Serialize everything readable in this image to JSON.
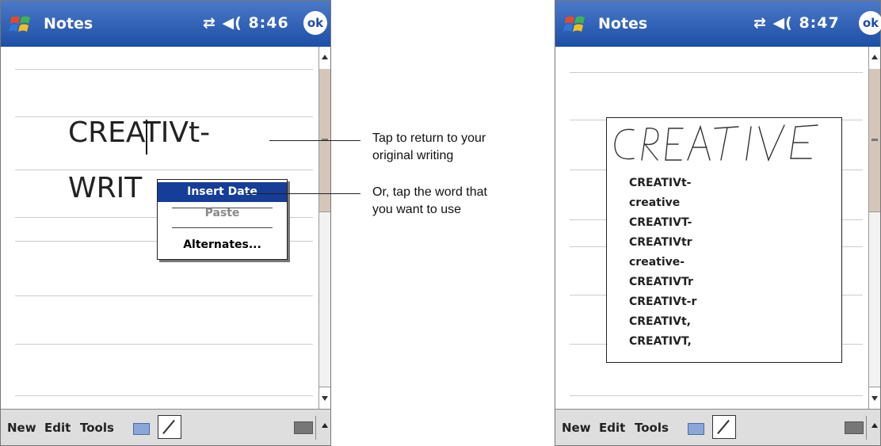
{
  "screen1": {
    "title": "Notes",
    "status": "⇄ ◀( 8:46",
    "ok": "ok",
    "text_line1": "CREATIVt-",
    "text_line2": "WRIT",
    "context_menu": {
      "items": [
        {
          "label": "Insert Date",
          "state": "highlighted"
        },
        {
          "label": "Paste",
          "state": "disabled"
        },
        {
          "label": "Alternates...",
          "state": "normal"
        }
      ]
    },
    "toolbar": {
      "new": "New",
      "edit": "Edit",
      "tools": "Tools"
    }
  },
  "screen2": {
    "title": "Notes",
    "status": "⇄ ◀( 8:47",
    "ok": "ok",
    "ink_word": "CREATIVE",
    "alternates": [
      "CREATIVt-",
      "creative",
      "CREATIVT-",
      "CREATIVtr",
      "creative-",
      "CREATIVTr",
      "CREATIVt-r",
      "CREATIVt,",
      "CREATIVT,"
    ],
    "toolbar": {
      "new": "New",
      "edit": "Edit",
      "tools": "Tools"
    }
  },
  "callouts": {
    "first_line1": "Tap to return to your",
    "first_line2": "original writing",
    "second_line1": "Or, tap the word that",
    "second_line2": "you want to use"
  },
  "colors": {
    "titlebar": "#1d4fa6",
    "menu_highlight": "#163d98",
    "scroll_thumb": "#d6c6b9"
  },
  "icons": [
    "windows-start-icon",
    "connectivity-icon",
    "speaker-icon",
    "keyboard-icon",
    "pen-icon"
  ]
}
